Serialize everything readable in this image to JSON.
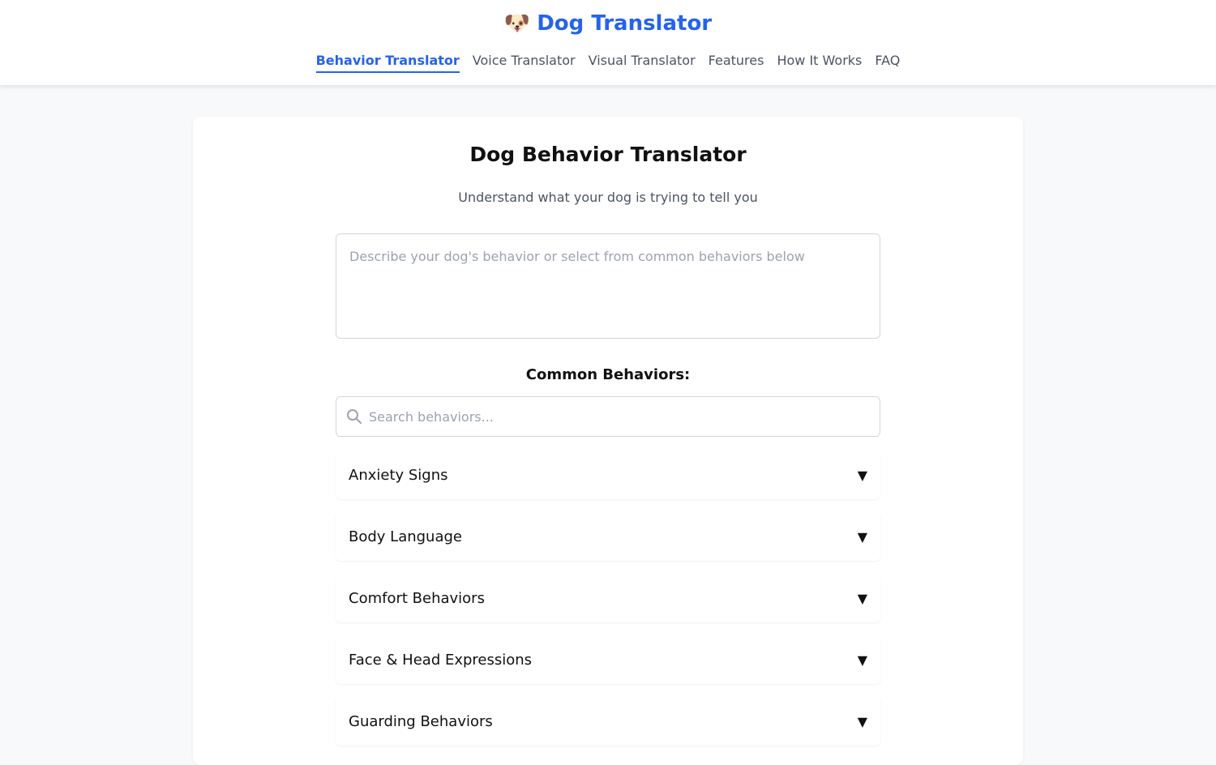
{
  "brand": {
    "logo": "🐶",
    "logo_icon": "dog-icon",
    "name": "Dog Translator",
    "color": "#2563eb"
  },
  "nav": {
    "items": [
      {
        "label": "Behavior Translator",
        "active": true
      },
      {
        "label": "Voice Translator",
        "active": false
      },
      {
        "label": "Visual Translator",
        "active": false
      },
      {
        "label": "Features",
        "active": false
      },
      {
        "label": "How It Works",
        "active": false
      },
      {
        "label": "FAQ",
        "active": false
      }
    ]
  },
  "main": {
    "title": "Dog Behavior Translator",
    "subtitle": "Understand what your dog is trying to tell you",
    "description_placeholder": "Describe your dog's behavior or select from common behaviors below",
    "description_value": "",
    "common_title": "Common Behaviors:",
    "search": {
      "placeholder": "Search behaviors...",
      "value": "",
      "icon": "search-icon"
    },
    "categories": [
      {
        "label": "Anxiety Signs",
        "arrow": "▼"
      },
      {
        "label": "Body Language",
        "arrow": "▼"
      },
      {
        "label": "Comfort Behaviors",
        "arrow": "▼"
      },
      {
        "label": "Face & Head Expressions",
        "arrow": "▼"
      },
      {
        "label": "Guarding Behaviors",
        "arrow": "▼"
      }
    ]
  }
}
